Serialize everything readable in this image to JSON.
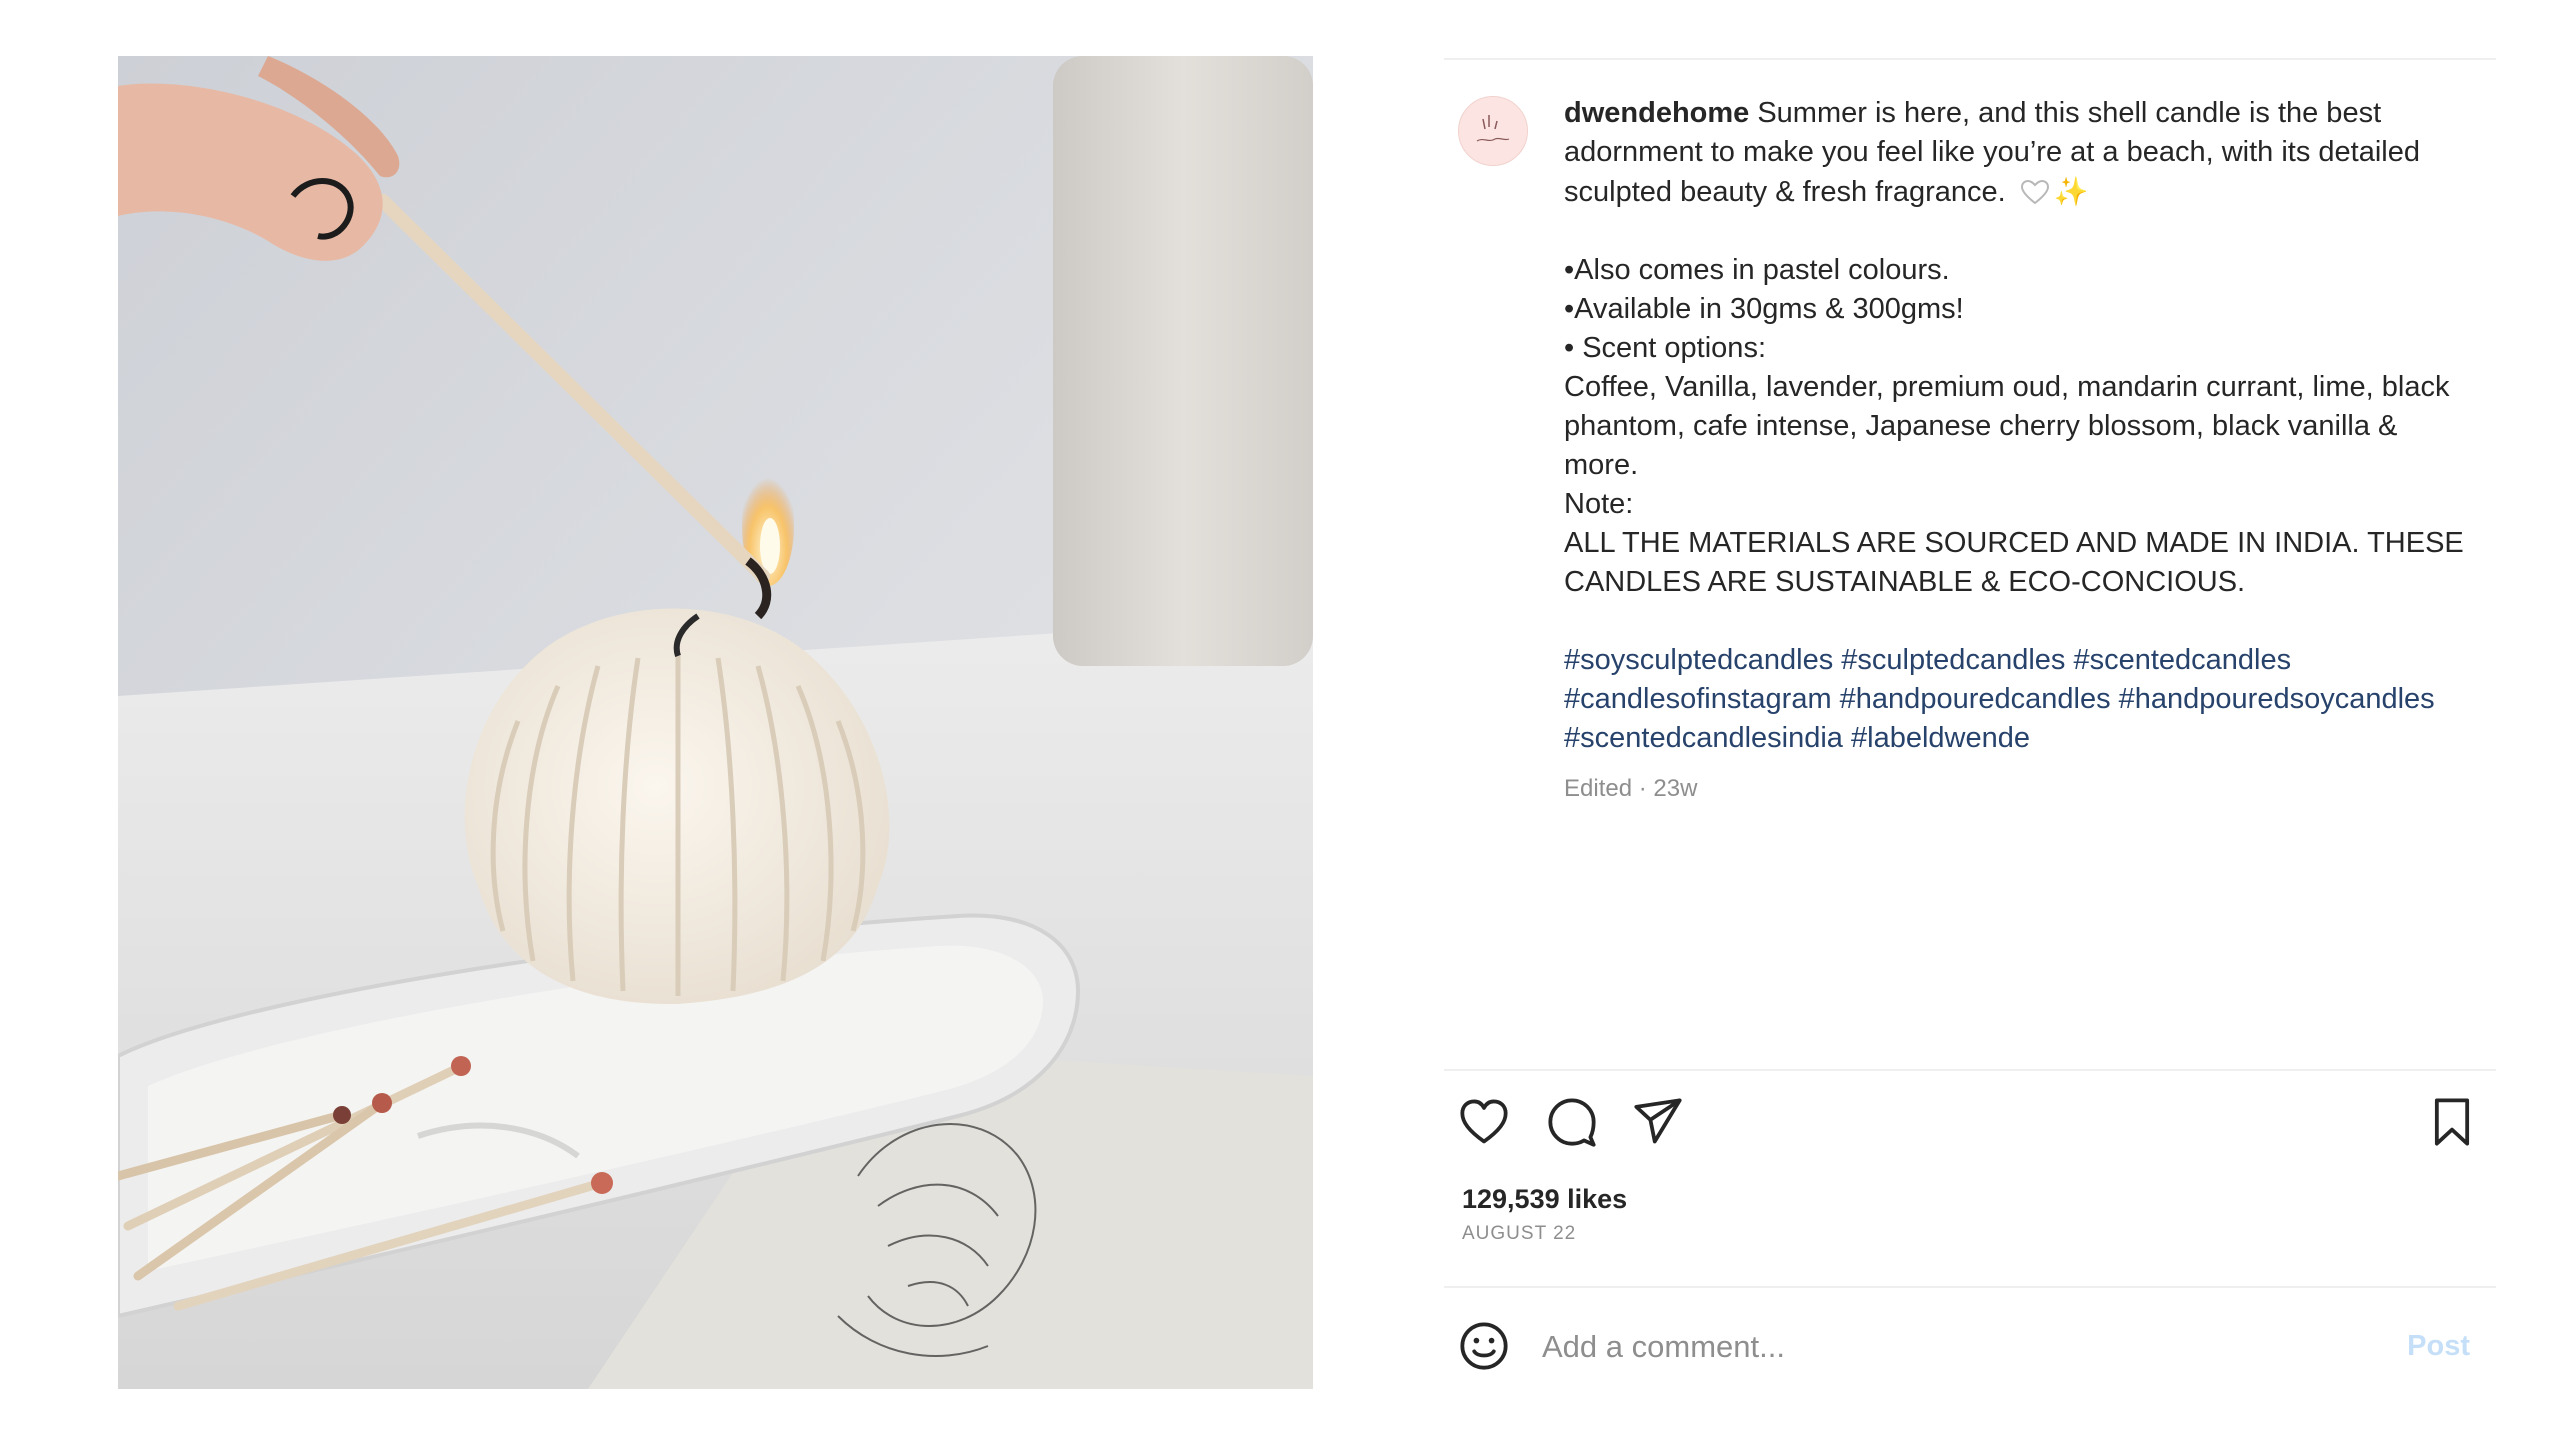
{
  "post": {
    "username": "dwendehome",
    "caption_intro": "Summer is here, and this shell candle is the best adornment to make you feel like you’re at a beach, with its detailed sculpted beauty & fresh fragrance.",
    "emoji_heart": "white-heart",
    "emoji_sparkles": "✨",
    "lines": [
      "•Also comes in pastel colours.",
      "•Available in 30gms & 300gms!",
      "• Scent options:",
      "Coffee, Vanilla, lavender, premium oud, mandarin currant, lime, black phantom, cafe intense, Japanese cherry blossom, black vanilla & more.",
      "Note:",
      "ALL THE MATERIALS ARE SOURCED AND MADE IN INDIA. THESE CANDLES ARE SUSTAINABLE & ECO-CONCIOUS."
    ],
    "hashtags": [
      "#soysculptedcandles",
      "#sculptedcandles",
      "#scentedcandles",
      "#candlesofinstagram",
      "#handpouredcandles",
      "#handpouredsoycandles",
      "#scentedcandlesindia",
      "#labeldwende"
    ],
    "edited_meta": "Edited · 23w",
    "likes": "129,539 likes",
    "date": "AUGUST 22"
  },
  "comment": {
    "placeholder": "Add a comment...",
    "post_label": "Post"
  },
  "icons": {
    "like": "heart-icon",
    "comment": "comment-icon",
    "share": "paper-plane-icon",
    "save": "bookmark-icon",
    "emoji": "smiley-icon"
  },
  "colors": {
    "hashtag": "#27426b",
    "muted": "#8e8e8e",
    "post_disabled": "#c5dff8",
    "text": "#262626"
  }
}
